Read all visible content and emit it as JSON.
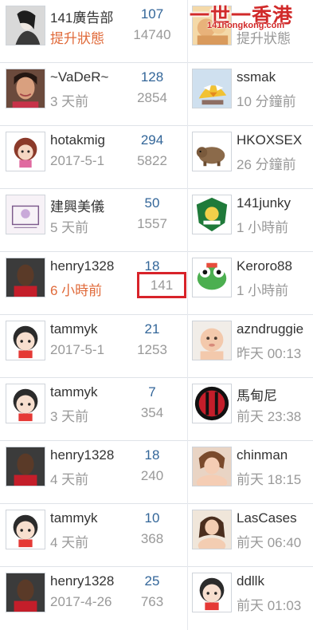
{
  "watermark": {
    "title": "一世一香港",
    "url": "141hongkong.com"
  },
  "rows": [
    {
      "left": {
        "name": "141廣告部",
        "time": "提升狀態",
        "replies": "107",
        "views": "14740"
      },
      "right": {
        "name": "",
        "time": "提升狀態"
      }
    },
    {
      "left": {
        "name": "~VaDeR~",
        "time": "3 天前",
        "replies": "128",
        "views": "2854"
      },
      "right": {
        "name": "ssmak",
        "time": "10 分鐘前"
      }
    },
    {
      "left": {
        "name": "hotakmig",
        "time": "2017-5-1",
        "replies": "294",
        "views": "5822"
      },
      "right": {
        "name": "HKOXSEX",
        "time": "26 分鐘前"
      }
    },
    {
      "left": {
        "name": "建興美儀",
        "time": "5 天前",
        "replies": "50",
        "views": "1557"
      },
      "right": {
        "name": "141junky",
        "time": "1 小時前"
      }
    },
    {
      "left": {
        "name": "henry1328",
        "time": "6 小時前",
        "replies": "18",
        "views": "141"
      },
      "right": {
        "name": "Keroro88",
        "time": "1 小時前"
      }
    },
    {
      "left": {
        "name": "tammyk",
        "time": "2017-5-1",
        "replies": "21",
        "views": "1253"
      },
      "right": {
        "name": "azndruggie",
        "time": "昨天 00:13"
      }
    },
    {
      "left": {
        "name": "tammyk",
        "time": "3 天前",
        "replies": "7",
        "views": "354"
      },
      "right": {
        "name": "馬甸尼",
        "time": "前天 23:38"
      }
    },
    {
      "left": {
        "name": "henry1328",
        "time": "4 天前",
        "replies": "18",
        "views": "240"
      },
      "right": {
        "name": "chinman",
        "time": "前天 18:15"
      }
    },
    {
      "left": {
        "name": "tammyk",
        "time": "4 天前",
        "replies": "10",
        "views": "368"
      },
      "right": {
        "name": "LasCases",
        "time": "前天 06:40"
      }
    },
    {
      "left": {
        "name": "henry1328",
        "time": "2017-4-26",
        "replies": "25",
        "views": "763"
      },
      "right": {
        "name": "ddllk",
        "time": "前天 01:03"
      }
    }
  ],
  "highlight": {
    "row_index": 4,
    "field": "views",
    "color": "#d8232a"
  },
  "colors": {
    "replies": "#336699",
    "muted": "#999999",
    "hot": "#e06a3a",
    "name": "#333333"
  }
}
